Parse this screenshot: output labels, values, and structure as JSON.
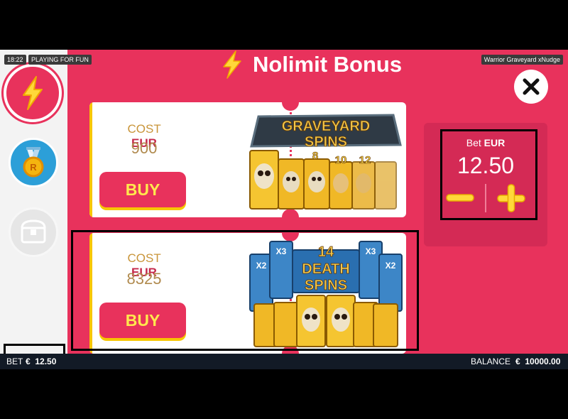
{
  "status": {
    "time": "18:22",
    "mode": "PLAYING FOR FUN",
    "game_name": "Warrior Graveyard xNudge"
  },
  "header": {
    "title": "Nolimit Bonus",
    "bolt_icon": "lightning-bolt-icon",
    "close_icon": "close-icon"
  },
  "sidebar": {
    "items": [
      {
        "name": "nolimit-bonus",
        "icon": "lightning-bolt-icon",
        "selected": true
      },
      {
        "name": "medal",
        "icon": "medal-icon",
        "selected": false
      },
      {
        "name": "chest",
        "icon": "treasure-chest-icon",
        "selected": false,
        "disabled": true
      }
    ]
  },
  "offers": [
    {
      "cost_label": "COST",
      "currency": "EUR",
      "cost": "900",
      "buy_label": "BUY",
      "art": {
        "line1": "GRAVEYARD",
        "line2": "SPINS",
        "numbers": [
          "8",
          "10",
          "12"
        ]
      }
    },
    {
      "cost_label": "COST",
      "currency": "EUR",
      "cost": "8325",
      "buy_label": "BUY",
      "art": {
        "count": "14",
        "line1": "DEATH",
        "line2": "SPINS",
        "multipliers": [
          "X2",
          "X3",
          "X3",
          "X2"
        ]
      }
    }
  ],
  "bet_panel": {
    "label": "Bet",
    "currency": "EUR",
    "value": "12.50",
    "minus_icon": "minus-icon",
    "plus_icon": "plus-icon"
  },
  "footer": {
    "bet_label": "BET",
    "bet_value": "€  12.50",
    "balance_label": "BALANCE",
    "balance_value": "€  10000.00"
  },
  "colors": {
    "accent": "#e8325c",
    "gold": "#f7c600",
    "sidebar": "#f3f3f3",
    "footer": "#121a26"
  }
}
